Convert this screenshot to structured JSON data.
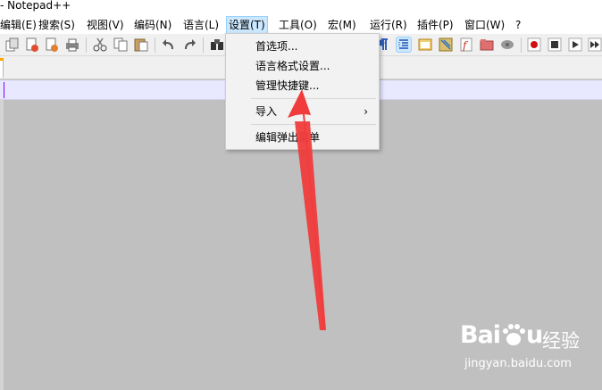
{
  "window": {
    "title": "- Notepad++"
  },
  "menubar": {
    "items": [
      {
        "label": "编辑(E)"
      },
      {
        "label": "搜索(S)"
      },
      {
        "label": "视图(V)"
      },
      {
        "label": "编码(N)"
      },
      {
        "label": "语言(L)"
      },
      {
        "label": "设置(T)"
      },
      {
        "label": "工具(O)"
      },
      {
        "label": "宏(M)"
      },
      {
        "label": "运行(R)"
      },
      {
        "label": "插件(P)"
      },
      {
        "label": "窗口(W)"
      },
      {
        "label": "?"
      }
    ]
  },
  "settings_menu": {
    "items": [
      {
        "label": "首选项..."
      },
      {
        "label": "语言格式设置..."
      },
      {
        "label": "管理快捷键..."
      },
      {
        "label": "导入",
        "submenu_arrow": "›"
      },
      {
        "label": "编辑弹出菜单"
      }
    ]
  },
  "toolbar": {
    "icons": [
      "close-all-icon",
      "close-icon",
      "close-all-but-icon",
      "print-icon",
      "cut-icon",
      "copy-icon",
      "paste-icon",
      "undo-icon",
      "redo-icon",
      "find-icon",
      "show-all-chars-icon",
      "indent-guide-icon",
      "user-lang-icon",
      "doc-map-icon",
      "function-list-icon",
      "folder-workspace-icon",
      "monitor-icon",
      "record-macro-icon",
      "stop-macro-icon",
      "play-macro-icon",
      "run-macro-multiple-icon"
    ]
  },
  "watermark": {
    "logo": "Bai",
    "logo_suffix": "u",
    "cn": "经验",
    "url": "jingyan.baidu.com"
  },
  "colors": {
    "editor_bg": "#c0c0c0",
    "current_line": "#e8e8ff",
    "menu_hover": "#cce8ff",
    "annotation_arrow": "#f03c3c"
  }
}
